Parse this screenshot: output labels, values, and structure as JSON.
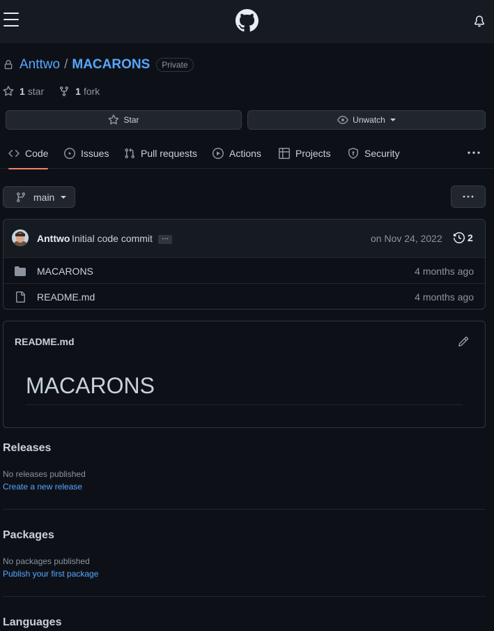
{
  "header": {
    "menu_icon": "hamburger-icon",
    "logo_icon": "github-logo-icon",
    "notif_icon": "bell-icon"
  },
  "repo": {
    "owner": "Anttwo",
    "separator": "/",
    "name": "MACARONS",
    "visibility": "Private"
  },
  "stats": {
    "stars_count": "1",
    "stars_label": "star",
    "forks_count": "1",
    "forks_label": "fork"
  },
  "actions": {
    "star_label": "Star",
    "watch_label": "Unwatch"
  },
  "tabs": [
    {
      "label": "Code",
      "icon": "code-icon",
      "active": true
    },
    {
      "label": "Issues",
      "icon": "issue-icon"
    },
    {
      "label": "Pull requests",
      "icon": "pull-request-icon"
    },
    {
      "label": "Actions",
      "icon": "play-icon"
    },
    {
      "label": "Projects",
      "icon": "table-icon"
    },
    {
      "label": "Security",
      "icon": "shield-icon"
    }
  ],
  "branch": {
    "name": "main"
  },
  "commit": {
    "author": "Anttwo",
    "message": "Initial code commit",
    "ellipsis": "…",
    "date": "on Nov 24, 2022",
    "history_count": "2"
  },
  "files": [
    {
      "name": "MACARONS",
      "type": "folder",
      "age": "4 months ago"
    },
    {
      "name": "README.md",
      "type": "file",
      "age": "4 months ago"
    }
  ],
  "readme": {
    "filename": "README.md",
    "heading": "MACARONS"
  },
  "releases": {
    "title": "Releases",
    "empty": "No releases published",
    "link": "Create a new release"
  },
  "packages": {
    "title": "Packages",
    "empty": "No packages published",
    "link": "Publish your first package"
  },
  "languages": {
    "title": "Languages"
  },
  "colors": {
    "bg": "#0d1117",
    "header": "#161b22",
    "link": "#58a6ff",
    "active_tab": "#f78166",
    "muted": "#8b949e"
  }
}
